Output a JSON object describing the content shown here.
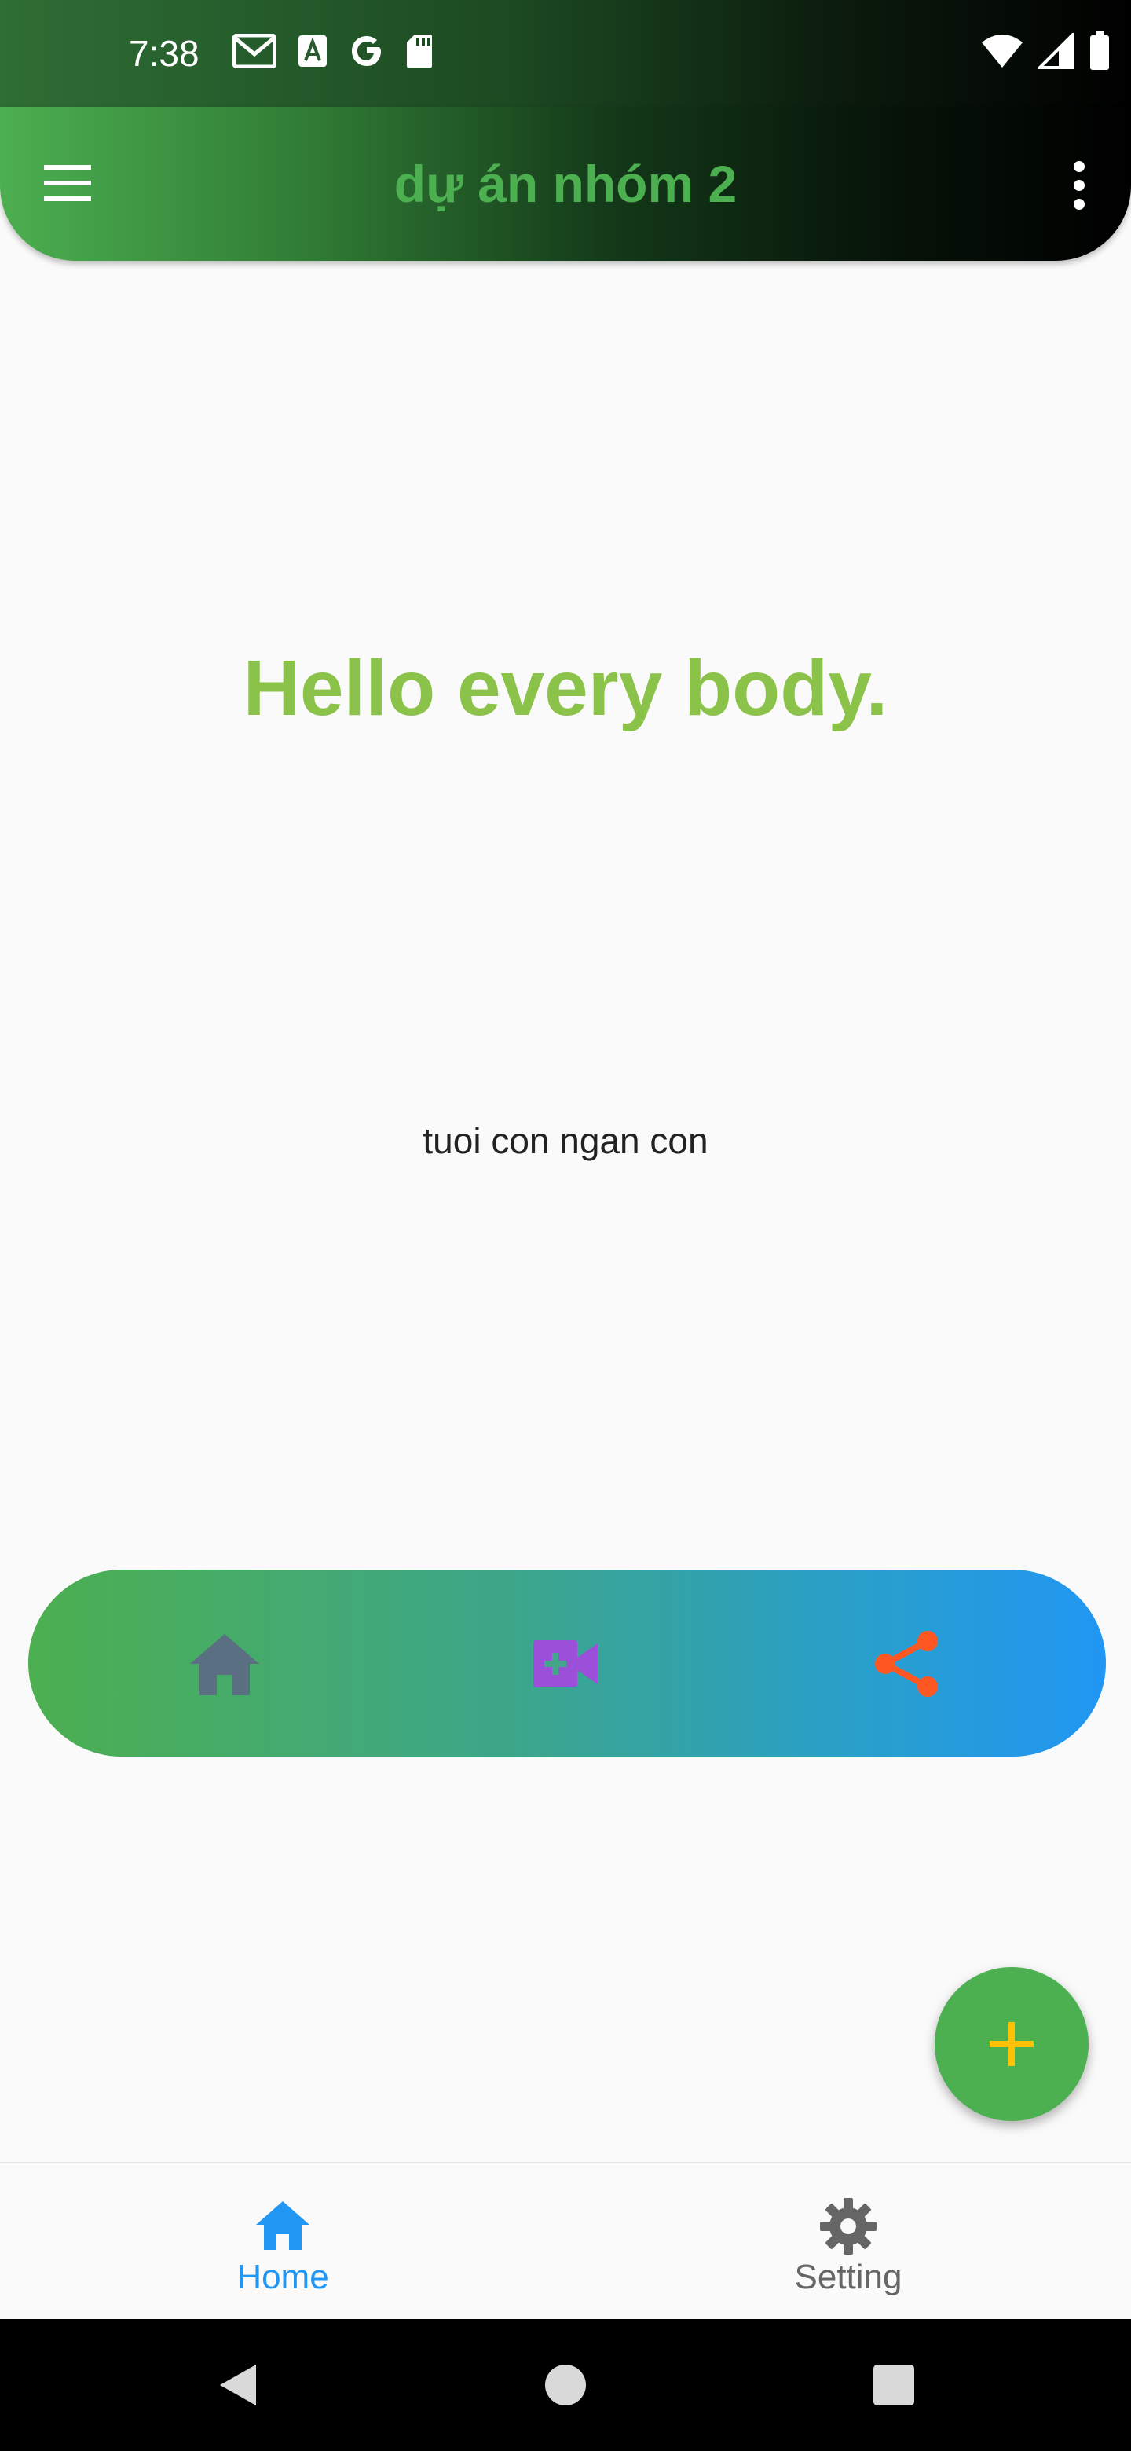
{
  "status_bar": {
    "time": "7:38",
    "left_icons": [
      "gmail-icon",
      "font-a-icon",
      "google-icon",
      "sd-card-icon"
    ],
    "right_icons": [
      "wifi-icon",
      "signal-icon",
      "battery-icon"
    ]
  },
  "app_bar": {
    "title": "dự án nhóm 2",
    "title_color": "#4caf50",
    "gradient_start": "#4caf50",
    "gradient_end": "#000000"
  },
  "content": {
    "headline": "Hello every body.",
    "headline_color": "#8bc34a",
    "subtext": "tuoi con ngan con"
  },
  "action_bar": {
    "items": [
      {
        "icon": "home-icon",
        "color": "#5b6f82"
      },
      {
        "icon": "video-call-icon",
        "color": "#9c4fd8"
      },
      {
        "icon": "share-icon",
        "color": "#ff5722"
      }
    ],
    "gradient_start": "#4caf50",
    "gradient_end": "#2196f3"
  },
  "fab": {
    "icon": "plus-icon",
    "color": "#4caf50",
    "icon_color": "#ffc107"
  },
  "bottom_nav": {
    "items": [
      {
        "label": "Home",
        "icon": "home-icon",
        "active": true,
        "color": "#2196f3"
      },
      {
        "label": "Setting",
        "icon": "gear-icon",
        "active": false,
        "color": "#666666"
      }
    ]
  },
  "system_nav": {
    "buttons": [
      "back-icon",
      "home-circle-icon",
      "recents-icon"
    ]
  }
}
